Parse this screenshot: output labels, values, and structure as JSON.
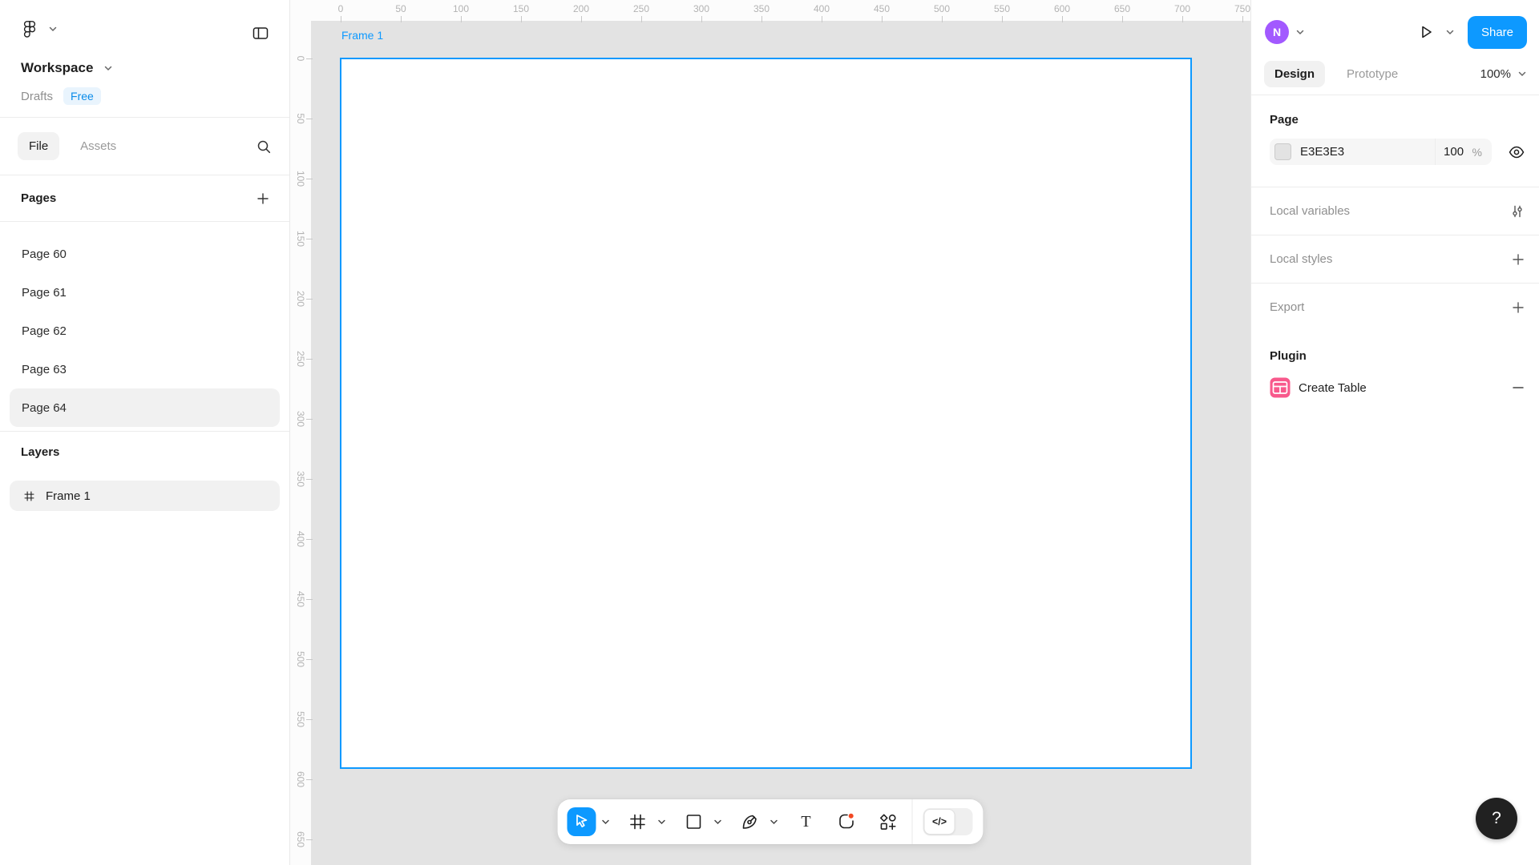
{
  "colors": {
    "accent": "#0D99FF",
    "selection": "#0D99FF",
    "avatar": "#A259FF",
    "notification_dot": "#F24822",
    "plugin_icon": "#F8598C",
    "page_background": "#E3E3E3",
    "frame_background": "#FFFFFF"
  },
  "left_sidebar": {
    "workspace": "Workspace",
    "drafts": "Drafts",
    "plan_badge": "Free",
    "file_tab": "File",
    "assets_tab": "Assets",
    "pages_header": "Pages",
    "pages": [
      {
        "label": "Page 60",
        "selected": false
      },
      {
        "label": "Page 61",
        "selected": false
      },
      {
        "label": "Page 62",
        "selected": false
      },
      {
        "label": "Page 63",
        "selected": false
      },
      {
        "label": "Page 64",
        "selected": true
      }
    ],
    "layers_header": "Layers",
    "layers": [
      {
        "label": "Frame 1",
        "selected": true,
        "icon": "frame-icon"
      }
    ]
  },
  "canvas": {
    "frame_label": "Frame 1",
    "h_ruler": [
      "0",
      "50",
      "100",
      "150",
      "200",
      "250",
      "300",
      "350",
      "400",
      "450",
      "500",
      "550",
      "600",
      "650",
      "700",
      "750"
    ],
    "v_ruler": [
      "0",
      "50",
      "100",
      "150",
      "200",
      "250",
      "300",
      "350",
      "400",
      "450",
      "500",
      "550",
      "600",
      "650"
    ]
  },
  "toolbar": {
    "tools": [
      "move",
      "frame",
      "shape",
      "pen",
      "text",
      "comment",
      "actions"
    ],
    "selected_tool": "move",
    "dev_mode": "</>"
  },
  "right_sidebar": {
    "avatar_initial": "N",
    "share_label": "Share",
    "design_tab": "Design",
    "prototype_tab": "Prototype",
    "zoom": "100%",
    "page_header": "Page",
    "page_color": {
      "hex": "E3E3E3",
      "opacity": "100",
      "unit": "%"
    },
    "sections": [
      {
        "label": "Local variables",
        "icon": "sliders-icon"
      },
      {
        "label": "Local styles",
        "icon": "plus-icon"
      },
      {
        "label": "Export",
        "icon": "plus-icon"
      }
    ],
    "plugin_header": "Plugin",
    "plugin_item": "Create Table"
  },
  "help": {
    "label": "?"
  }
}
